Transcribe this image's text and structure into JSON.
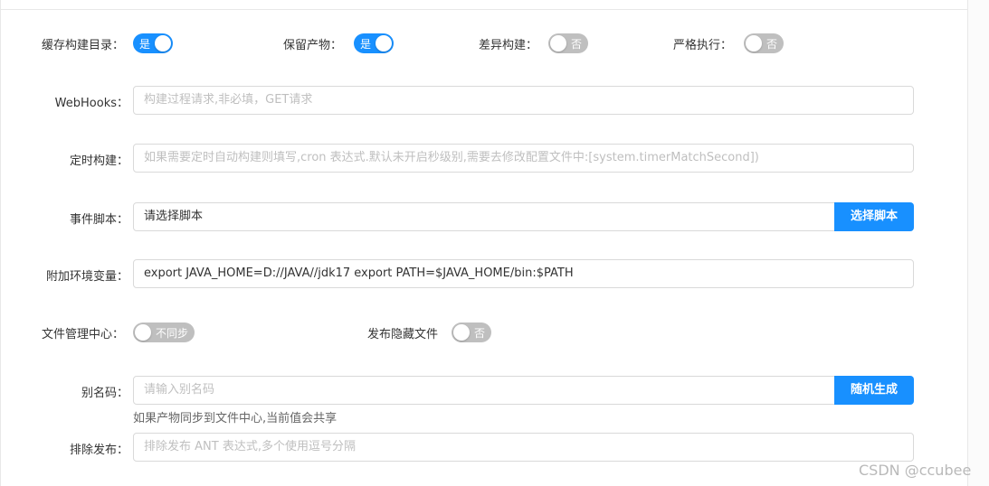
{
  "row1": {
    "cache_dir": {
      "label": "缓存构建目录：",
      "state": "是",
      "on": true
    },
    "keep_artifact": {
      "label": "保留产物：",
      "state": "是",
      "on": true
    },
    "diff_build": {
      "label": "差异构建：",
      "state": "否",
      "on": false
    },
    "strict_exec": {
      "label": "严格执行：",
      "state": "否",
      "on": false
    }
  },
  "webhooks": {
    "label": "WebHooks：",
    "placeholder": "构建过程请求,非必填，GET请求"
  },
  "scheduled_build": {
    "label": "定时构建：",
    "placeholder": "如果需要定时自动构建则填写,cron 表达式.默认未开启秒级别,需要去修改配置文件中:[system.timerMatchSecond])"
  },
  "event_script": {
    "label": "事件脚本：",
    "value": "请选择脚本",
    "button": "选择脚本"
  },
  "env_vars": {
    "label": "附加环境变量：",
    "value": "export JAVA_HOME=D://JAVA//jdk17 export PATH=$JAVA_HOME/bin:$PATH"
  },
  "file_center": {
    "label": "文件管理中心：",
    "state": "不同步",
    "on": false
  },
  "publish_hidden": {
    "label": "发布隐藏文件",
    "state": "否",
    "on": false
  },
  "alias_code": {
    "label": "别名码：",
    "placeholder": "请输入别名码",
    "button": "随机生成",
    "hint": "如果产物同步到文件中心,当前值会共享"
  },
  "exclude_publish": {
    "label": "排除发布：",
    "placeholder": "排除发布 ANT 表达式,多个使用逗号分隔"
  },
  "watermark": "CSDN @ccubee",
  "colors": {
    "primary": "#1890ff",
    "switch_off": "#bfbfbf",
    "border": "#d9d9d9"
  }
}
